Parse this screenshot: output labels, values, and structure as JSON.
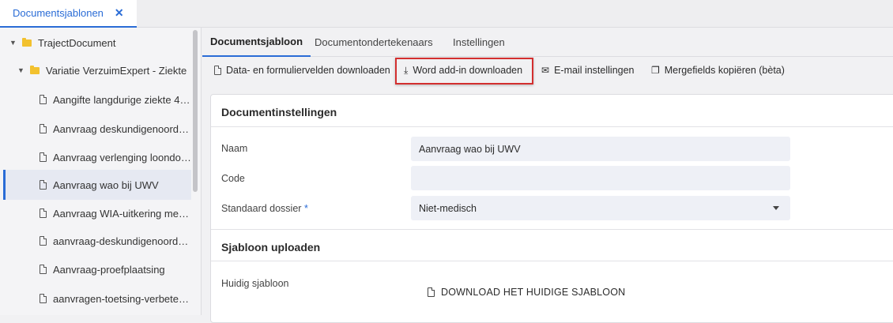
{
  "document_tab": {
    "label": "Documentsjablonen",
    "close": "✕"
  },
  "tree": {
    "items": [
      {
        "label": "TrajectDocument",
        "type": "folder"
      },
      {
        "label": "Variatie VerzuimExpert - Ziekte",
        "type": "folder"
      },
      {
        "label": "Aangifte langdurige ziekte 4…",
        "type": "file"
      },
      {
        "label": "Aanvraag deskundigenoorde…",
        "type": "file"
      },
      {
        "label": "Aanvraag verlenging loondo…",
        "type": "file"
      },
      {
        "label": "Aanvraag wao bij UWV",
        "type": "file",
        "selected": true
      },
      {
        "label": "Aanvraag WIA-uitkering met …",
        "type": "file"
      },
      {
        "label": "aanvraag-deskundigenoorde…",
        "type": "file"
      },
      {
        "label": "Aanvraag-proefplaatsing",
        "type": "file"
      },
      {
        "label": "aanvragen-toetsing-verbeter…",
        "type": "file"
      }
    ]
  },
  "tabs": [
    "Documentsjabloon",
    "Documentondertekenaars",
    "Instellingen"
  ],
  "toolbar": {
    "data_fields": "Data- en formuliervelden downloaden",
    "word_addin": "Word add-in downloaden",
    "email_settings": "E-mail instellingen",
    "mergefields": "Mergefields kopiëren (bèta)"
  },
  "settings": {
    "title": "Documentinstellingen",
    "name_label": "Naam",
    "name_value": "Aanvraag wao bij UWV",
    "code_label": "Code",
    "code_value": "",
    "dossier_label": "Standaard dossier",
    "dossier_required": "*",
    "dossier_value": "Niet-medisch"
  },
  "upload": {
    "title": "Sjabloon uploaden",
    "current_label": "Huidig sjabloon",
    "download_link": "DOWNLOAD HET HUIDIGE SJABLOON"
  },
  "colors": {
    "accent": "#2a6cd6",
    "highlight": "#d32f2f",
    "folder": "#f2c12e"
  }
}
